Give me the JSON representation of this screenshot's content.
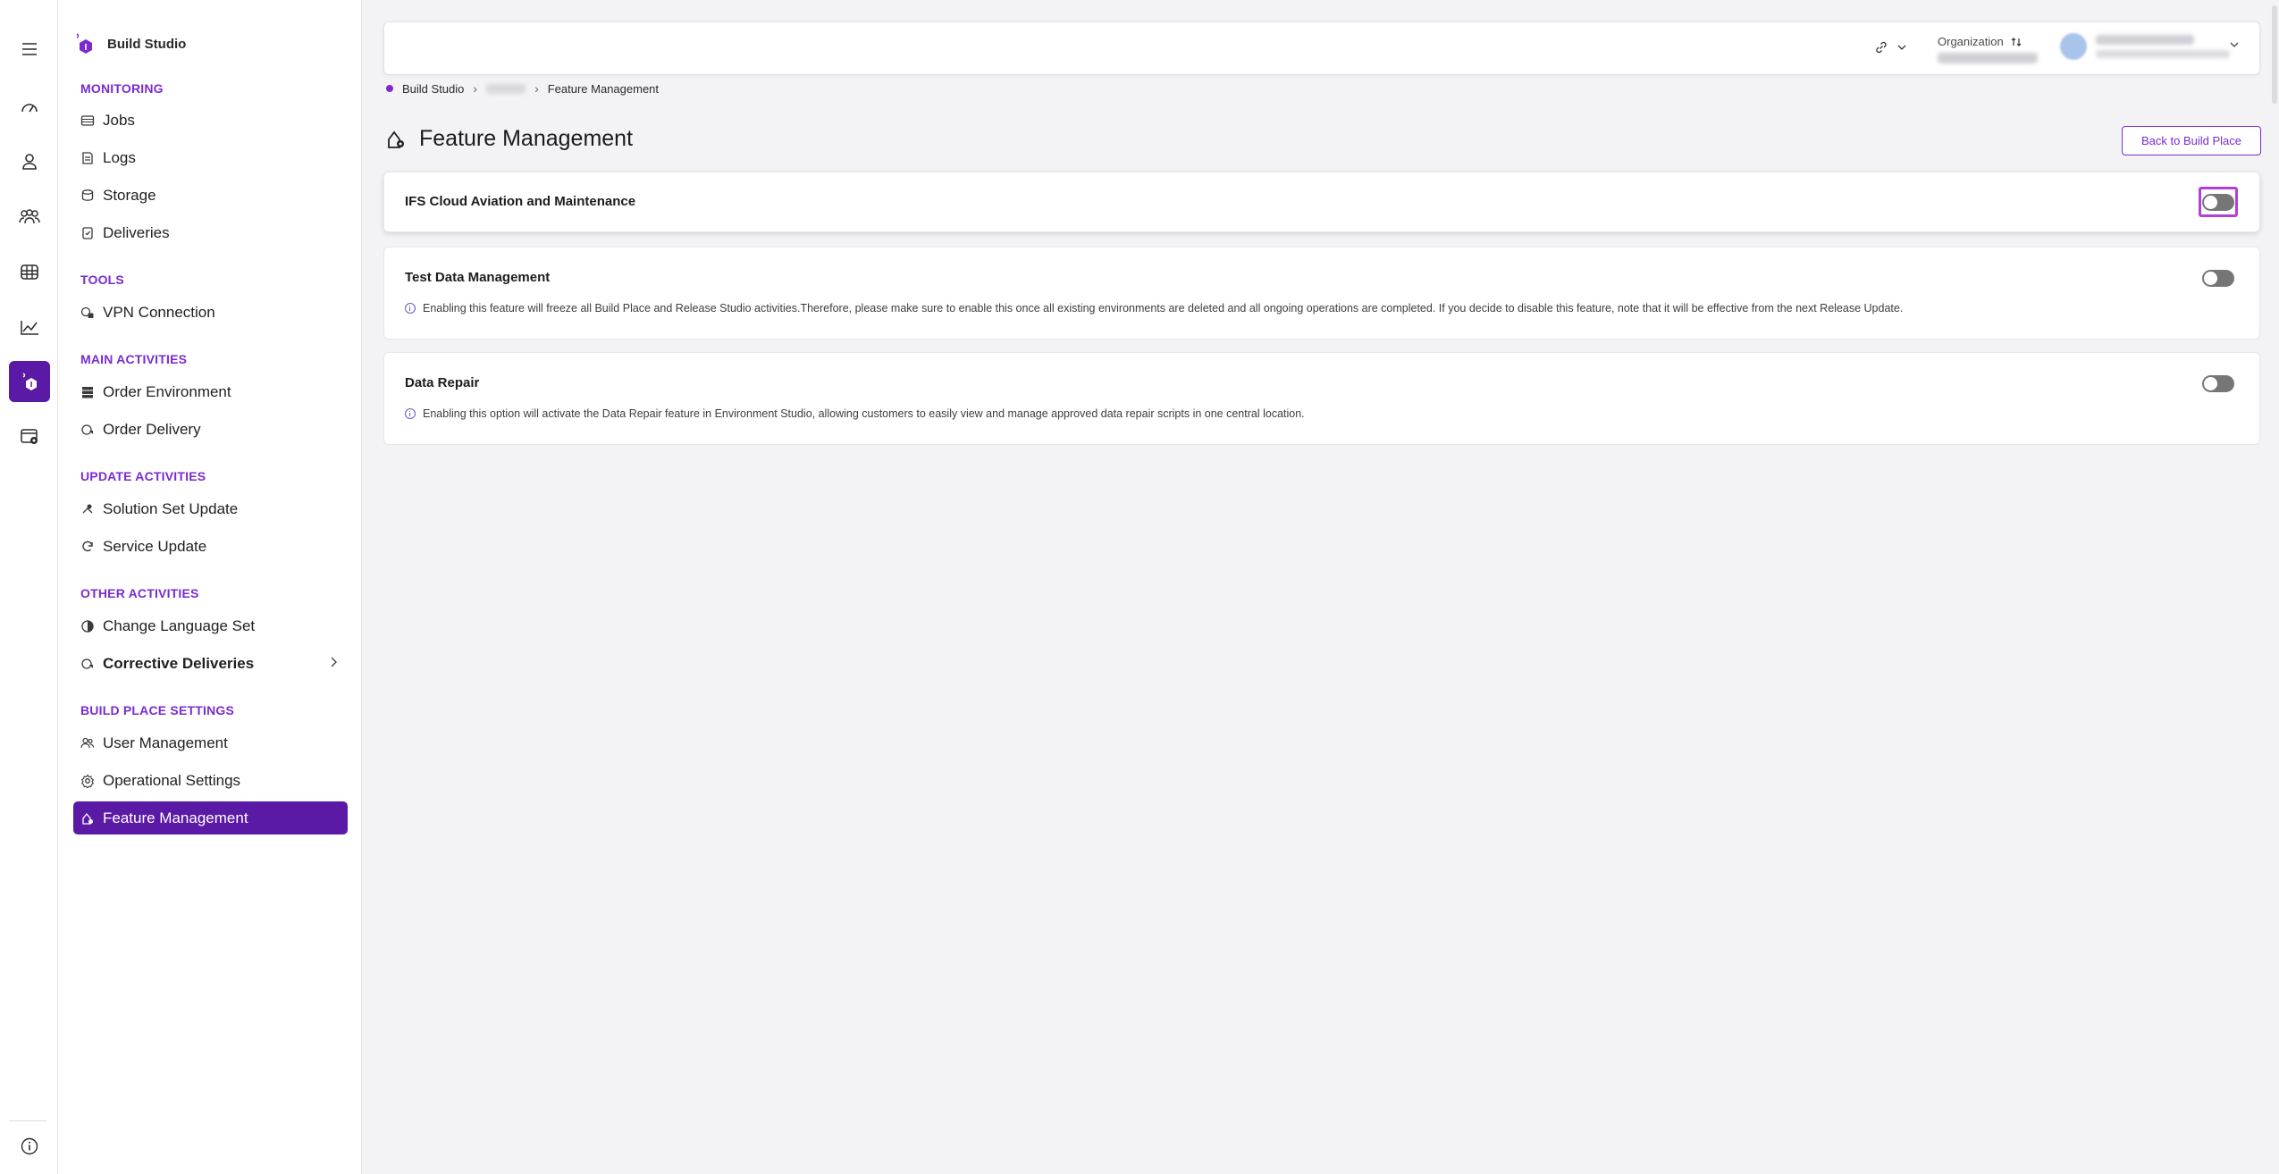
{
  "rail": {
    "icons": [
      "menu-icon",
      "dashboard-icon",
      "user-icon",
      "groups-icon",
      "grid-icon",
      "chart-icon",
      "build-studio-icon",
      "settings-window-icon",
      "info-icon"
    ],
    "active": "build-studio-icon"
  },
  "sidebar": {
    "brand": "Build Studio",
    "sections": {
      "monitoring": "MONITORING",
      "tools": "TOOLS",
      "main": "MAIN ACTIVITIES",
      "update": "UPDATE ACTIVITIES",
      "other": "OTHER ACTIVITIES",
      "settings": "BUILD PLACE SETTINGS"
    },
    "items": {
      "jobs": "Jobs",
      "logs": "Logs",
      "storage": "Storage",
      "deliveries": "Deliveries",
      "vpn": "VPN Connection",
      "order_env": "Order Environment",
      "order_delivery": "Order Delivery",
      "solution_set": "Solution Set Update",
      "service_update": "Service Update",
      "change_lang": "Change Language Set",
      "corrective": "Corrective Deliveries",
      "user_mgmt": "User Management",
      "operational": "Operational Settings",
      "feature_mgmt": "Feature Management"
    },
    "active_item": "Feature Management"
  },
  "header": {
    "organization_label": "Organization"
  },
  "breadcrumb": {
    "root": "Build Studio",
    "current": "Feature Management"
  },
  "page": {
    "title": "Feature Management",
    "back_button": "Back to Build Place"
  },
  "features": [
    {
      "title": "IFS Cloud Aviation and Maintenance",
      "description": "",
      "enabled": false,
      "focused": true
    },
    {
      "title": "Test Data Management",
      "description": "Enabling this feature will freeze all Build Place and Release Studio activities.Therefore, please make sure to enable this once all existing environments are deleted and all ongoing operations are completed. If you decide to disable this feature, note that it will be effective from the next Release Update.",
      "enabled": false,
      "focused": false
    },
    {
      "title": "Data Repair",
      "description": "Enabling this option will activate the Data Repair feature in Environment Studio, allowing customers to easily view and manage approved data repair scripts in one central location.",
      "enabled": false,
      "focused": false
    }
  ],
  "colors": {
    "accent": "#7a2bd0",
    "active_bg": "#5b1aa6",
    "toggle_off": "#767676",
    "focus_ring": "#b140d8"
  }
}
